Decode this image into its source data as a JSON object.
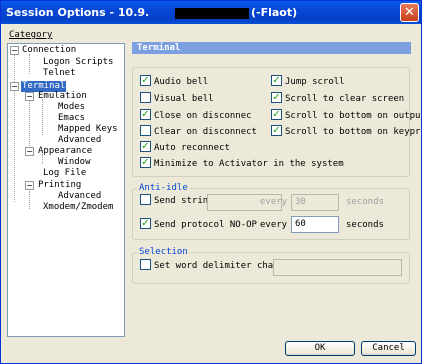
{
  "window": {
    "title": "Session Options - 10.9.",
    "title_suffix": "(-Flaot)",
    "close_glyph": "✕"
  },
  "category_label": "Category",
  "tree": {
    "connection": "Connection",
    "logon_scripts": "Logon Scripts",
    "telnet": "Telnet",
    "terminal": "Terminal",
    "emulation": "Emulation",
    "modes": "Modes",
    "emacs": "Emacs",
    "mapped_keys": "Mapped Keys",
    "advanced": "Advanced",
    "appearance": "Appearance",
    "window": "Window",
    "log_file": "Log File",
    "printing": "Printing",
    "printing_advanced": "Advanced",
    "xmodem": "Xmodem/Zmodem",
    "expand_glyph": "−"
  },
  "panel_title": "Terminal",
  "options": {
    "audio_bell": {
      "label": "Audio bell",
      "checked": true
    },
    "jump_scroll": {
      "label": "Jump scroll",
      "checked": true
    },
    "visual_bell": {
      "label": "Visual bell",
      "checked": false
    },
    "scroll_clear": {
      "label": "Scroll to clear screen",
      "checked": true
    },
    "close_disconnect": {
      "label": "Close on disconnec",
      "checked": true
    },
    "scroll_output": {
      "label": "Scroll to bottom on outpu",
      "checked": true
    },
    "clear_disconnect": {
      "label": "Clear on disconnect",
      "checked": false
    },
    "scroll_keypress": {
      "label": "Scroll to bottom on keypr",
      "checked": true
    },
    "auto_reconnect": {
      "label": "Auto reconnect",
      "checked": true
    },
    "minimize_activator": {
      "label": "Minimize to Activator in the system",
      "checked": true
    }
  },
  "anti_idle": {
    "label": "Anti-idle",
    "send_string": {
      "label": "Send strin",
      "checked": false,
      "value": "",
      "every": "every",
      "interval": "30",
      "unit": "seconds"
    },
    "send_noop": {
      "label": "Send protocol NO-OP",
      "checked": true,
      "every": "every",
      "interval": "60",
      "unit": "seconds"
    }
  },
  "selection": {
    "label": "Selection",
    "word_delim": {
      "label": "Set word delimiter chara",
      "checked": false,
      "value": ""
    }
  },
  "buttons": {
    "ok": "OK",
    "cancel": "Cancel"
  },
  "check_glyph": "✓",
  "colors": {
    "title_bar": "#0846d4",
    "header": "#7b9fe0",
    "group_label": "#0046d5",
    "check": "#21a121",
    "selection": "#316ac5"
  }
}
